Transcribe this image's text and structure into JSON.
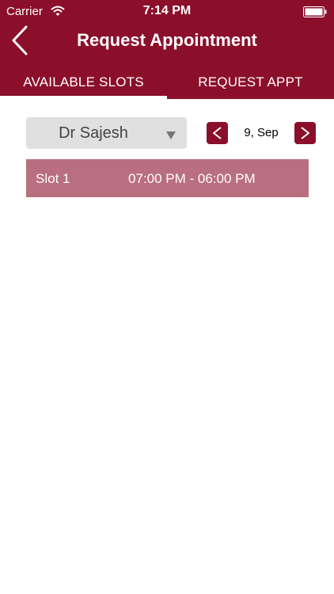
{
  "status_bar": {
    "carrier": "Carrier",
    "time": "7:14 PM"
  },
  "nav": {
    "title": "Request Appointment",
    "back_icon": "chevron-left-icon"
  },
  "tabs": [
    {
      "label": "AVAILABLE SLOTS",
      "selected": true
    },
    {
      "label": "REQUEST APPT",
      "selected": false
    }
  ],
  "doctor_select": {
    "value": "Dr Sajesh"
  },
  "date": {
    "label": "9, Sep",
    "prev_label": "<",
    "next_label": ">"
  },
  "slots": [
    {
      "name": "Slot 1",
      "time": "07:00 PM - 06:00 PM"
    }
  ],
  "colors": {
    "brand": "#8b0f2b",
    "slot_row": "#b96f80",
    "select_bg": "#e0e0e0"
  }
}
